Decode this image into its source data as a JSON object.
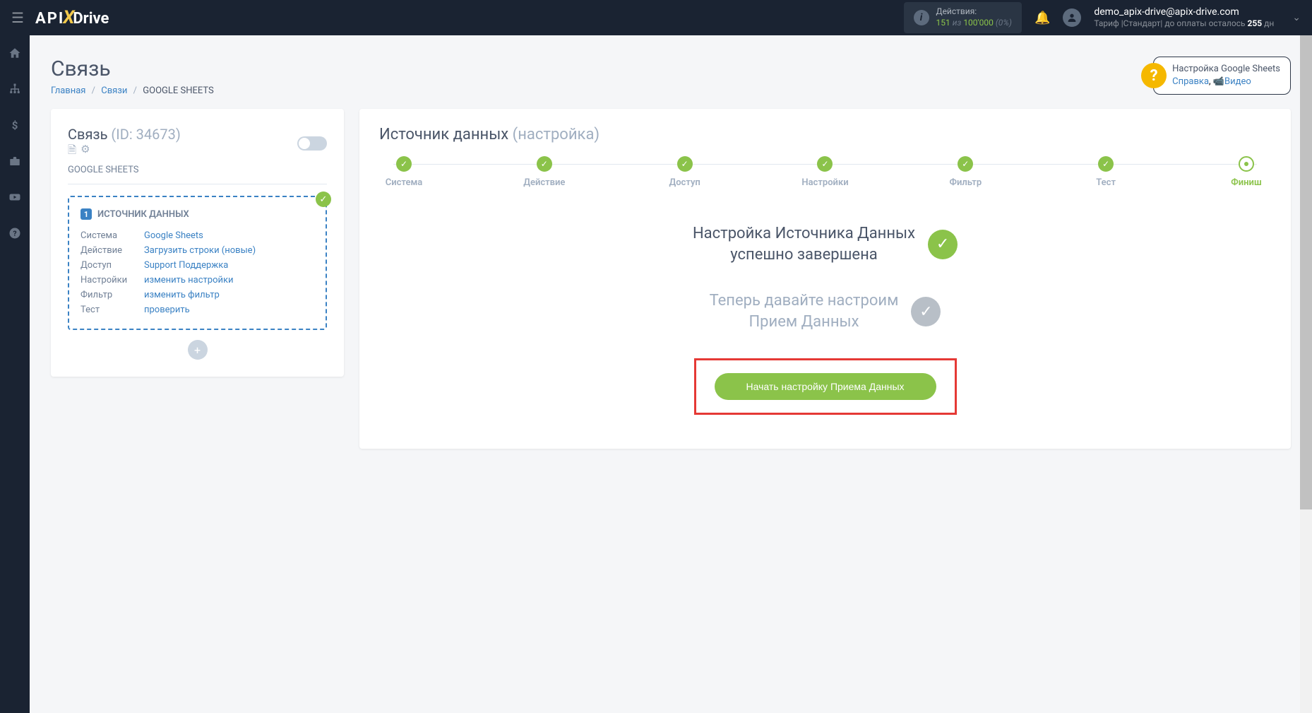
{
  "topbar": {
    "actions_label": "Действия:",
    "actions_value": "151",
    "actions_of": " из ",
    "actions_limit": "100'000",
    "actions_percent": " (0%)",
    "user_email": "demo_apix-drive@apix-drive.com",
    "user_tariff_prefix": "Тариф |Стандарт| до оплаты осталось ",
    "user_tariff_days": "255",
    "user_tariff_unit": " дн"
  },
  "page": {
    "title": "Связь",
    "breadcrumb": {
      "home": "Главная",
      "connects": "Связи",
      "current": "GOOGLE SHEETS"
    }
  },
  "help": {
    "title": "Настройка Google Sheets",
    "link_help": "Справка",
    "link_video": "Видео"
  },
  "leftcard": {
    "title": "Связь",
    "id_label": "(ID: 34673)",
    "subtitle": "GOOGLE SHEETS",
    "source_header": "ИСТОЧНИК ДАННЫХ",
    "rows": [
      {
        "label": "Система",
        "value": "Google Sheets"
      },
      {
        "label": "Действие",
        "value": "Загрузить строки (новые)"
      },
      {
        "label": "Доступ",
        "value": "Support Поддержка"
      },
      {
        "label": "Настройки",
        "value": "изменить настройки"
      },
      {
        "label": "Фильтр",
        "value": "изменить фильтр"
      },
      {
        "label": "Тест",
        "value": "проверить"
      }
    ]
  },
  "rightcard": {
    "title": "Источник данных",
    "subtitle": "(настройка)",
    "steps": [
      {
        "label": "Система",
        "done": true
      },
      {
        "label": "Действие",
        "done": true
      },
      {
        "label": "Доступ",
        "done": true
      },
      {
        "label": "Настройки",
        "done": true
      },
      {
        "label": "Фильтр",
        "done": true
      },
      {
        "label": "Тест",
        "done": true
      },
      {
        "label": "Финиш",
        "active": true
      }
    ],
    "success_line1": "Настройка Источника Данных",
    "success_line2": "успешно завершена",
    "next_line1": "Теперь давайте настроим",
    "next_line2": "Прием Данных",
    "cta": "Начать настройку Приема Данных"
  }
}
